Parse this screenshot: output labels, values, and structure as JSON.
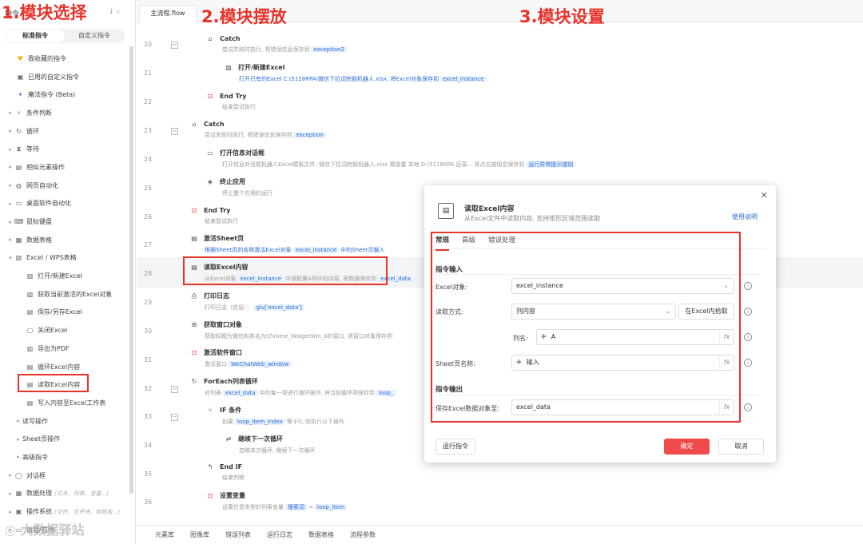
{
  "annotations": {
    "a1": "1.模块选择",
    "a2": "2.模块摆放",
    "a3": "3.模块设置"
  },
  "left": {
    "title": "指令",
    "tabs": [
      "标准指令",
      "自定义指令"
    ],
    "items": [
      {
        "label": "我收藏的指令",
        "icon": "heart-icon"
      },
      {
        "label": "已用的自定义指令",
        "icon": "box-icon"
      },
      {
        "label": "魔法指令 (Beta)",
        "icon": "magic-icon"
      },
      {
        "label": "条件判断",
        "icon": "branch-icon"
      },
      {
        "label": "循环",
        "icon": "loop-icon"
      },
      {
        "label": "等待",
        "icon": "hourglass-icon"
      },
      {
        "label": "相似元素操作",
        "icon": "similar-icon"
      },
      {
        "label": "网页自动化",
        "icon": "globe-icon"
      },
      {
        "label": "桌面软件自动化",
        "icon": "desktop-icon"
      },
      {
        "label": "鼠标键盘",
        "icon": "mouse-icon"
      },
      {
        "label": "数据表格",
        "icon": "table-icon"
      },
      {
        "label": "Excel / WPS表格",
        "icon": "excel-icon"
      },
      {
        "label": "打开/新建Excel",
        "icon": "excel-icon"
      },
      {
        "label": "获取当前激活的Excel对象",
        "icon": "excel-icon"
      },
      {
        "label": "保存/另存Excel",
        "icon": "save-icon"
      },
      {
        "label": "关闭Excel",
        "icon": "close-file-icon"
      },
      {
        "label": "导出为PDF",
        "icon": "pdf-icon"
      },
      {
        "label": "循环Excel内容",
        "icon": "loop-excel-icon"
      },
      {
        "label": "读取Excel内容",
        "icon": "read-excel-icon"
      },
      {
        "label": "写入内容至Excel工作表",
        "icon": "write-excel-icon"
      },
      {
        "label": "读写操作",
        "icon": ""
      },
      {
        "label": "Sheet页操作",
        "icon": ""
      },
      {
        "label": "高级指令",
        "icon": ""
      },
      {
        "label": "对话框",
        "icon": "dialog-icon"
      },
      {
        "label": "数据处理",
        "icon": "data-icon",
        "sub": "(文本、列表、变量...)"
      },
      {
        "label": "操作系统",
        "icon": "os-icon",
        "sub": "(文件、文件夹、剪贴板...)"
      },
      {
        "label": "流程/应用",
        "icon": "flow-icon"
      }
    ]
  },
  "file_tab": "主流程.flow",
  "flow": [
    {
      "ln": "20",
      "title": "Catch",
      "desc": "尝试失败时执行, 将错误信息保存到",
      "tag": "exception2"
    },
    {
      "ln": "21",
      "title": "打开/新建Excel",
      "desc": "打开已有的Excel C:\\5118RPA\\微信下拉词挖掘机器人.xlsx, 将Excel对象保存到",
      "tag": "excel_instance"
    },
    {
      "ln": "22",
      "title": "End Try",
      "desc": "结束尝试执行"
    },
    {
      "ln": "23",
      "title": "Catch",
      "desc": "尝试失败时执行, 将错误信息保存到",
      "tag": "exception"
    },
    {
      "ln": "24",
      "title": "打开信息对话框",
      "desc": "打开信息对话框机器人Excel模板文件: 微信下拉词挖掘机器人.xlsx  需放置 本地 D:\\5118RPA 目录...  将点击按钮名保存到",
      "tag": "运行异常提示按钮"
    },
    {
      "ln": "25",
      "title": "终止应用",
      "desc": "停止整个应用的运行"
    },
    {
      "ln": "26",
      "title": "End Try",
      "desc": "结束尝试执行"
    },
    {
      "ln": "27",
      "title": "激活Sheet页",
      "desc": "根据Sheet页的名称激活Excel对象",
      "tag": "excel_instance",
      "desc2": "中的Sheet页输入"
    },
    {
      "ln": "28",
      "title": "读取Excel内容",
      "desc": "从Excel对象",
      "tag": "excel_instance",
      "desc2": "中读取第A列中的内容, 将数据保存到",
      "tag2": "excel_data"
    },
    {
      "ln": "29",
      "title": "打印日志",
      "desc": "打印日志（信息）：",
      "tag": "glv['excel_data']"
    },
    {
      "ln": "30",
      "title": "获取窗口对象",
      "desc": "获取标题为微信和类名为Chrome_WidgetWin_0的窗口, 将窗口对象保存到"
    },
    {
      "ln": "31",
      "title": "激活软件窗口",
      "desc": "激活窗口",
      "tag": "WeChatWeb_window"
    },
    {
      "ln": "32",
      "title": "ForEach列表循环",
      "desc": "对列表",
      "tag": "excel_data",
      "desc2": "中的每一项进行循环操作, 将当前循环项保存到",
      "tag2": "loop_"
    },
    {
      "ln": "33",
      "title": "IF 条件",
      "desc": "如果",
      "tag": "loop_item_index",
      "desc2": "等于0, 则执行以下操作"
    },
    {
      "ln": "34",
      "title": "继续下一次循环",
      "desc": "忽略本次循环, 继续下一次循环"
    },
    {
      "ln": "35",
      "title": "End IF",
      "desc": "结束判断"
    },
    {
      "ln": "36",
      "title": "设置变量",
      "desc": "设置任意类型的列表变量",
      "tag": "搜索词",
      "desc2": "=",
      "tag2": "loop_item"
    }
  ],
  "bottom_tabs": [
    "元素库",
    "图像库",
    "错误列表",
    "运行日志",
    "数据表格",
    "流程参数"
  ],
  "dialog": {
    "title": "读取Excel内容",
    "desc": "从Excel文件中读取内容, 支持矩形区域范围读取",
    "help": "使用说明",
    "tabs": [
      "常规",
      "高级",
      "错误处理"
    ],
    "section_in": "指令输入",
    "excel_label": "Excel对象:",
    "excel_value": "excel_instance",
    "mode_label": "读取方式:",
    "mode_value": "列内容",
    "pick_btn": "在Excel内拾取",
    "col_label": "列名:",
    "col_value": "A",
    "sheet_label": "Sheet页名称:",
    "sheet_value": "输入",
    "section_out": "指令输出",
    "out_label": "保存Excel数据对象至:",
    "out_value": "excel_data",
    "run_btn": "运行指令",
    "ok_btn": "确定",
    "cancel_btn": "取消"
  },
  "watermark": "大数据驿站",
  "colors": {
    "accent": "#e8332a",
    "link": "#2a6bd8",
    "primary_btn": "#f04a4a"
  }
}
